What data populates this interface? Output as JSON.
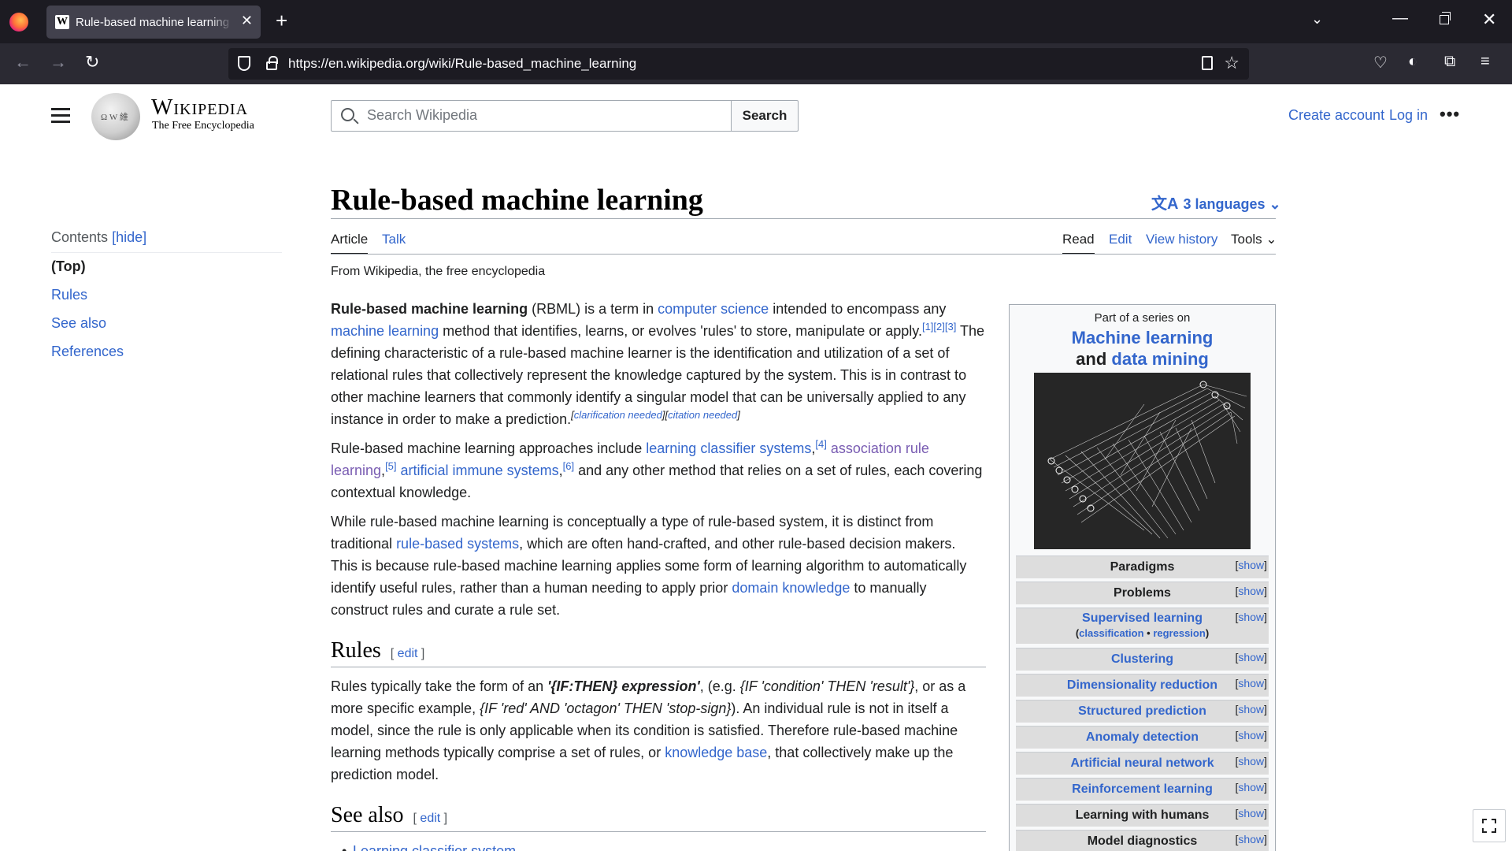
{
  "browser": {
    "tab_title": "Rule-based machine learning - Wikipedia",
    "url": "https://en.wikipedia.org/wiki/Rule-based_machine_learning",
    "icons": [
      "firefox-logo",
      "close-icon",
      "plus-icon",
      "chevron-down-icon",
      "minimize-icon",
      "restore-icon",
      "back-icon",
      "forward-icon",
      "reload-icon",
      "shield-icon",
      "lock-icon",
      "reader-icon",
      "star-icon",
      "pocket-icon",
      "account-icon",
      "extensions-icon",
      "menu-icon"
    ]
  },
  "header": {
    "wordmark": "Wikipedia",
    "tagline": "The Free Encyclopedia",
    "search_placeholder": "Search Wikipedia",
    "search_button": "Search",
    "create_account": "Create account",
    "login": "Log in",
    "more": "•••"
  },
  "toc": {
    "title": "Contents",
    "hide": "[hide]",
    "items": [
      "(Top)",
      "Rules",
      "See also",
      "References"
    ]
  },
  "article": {
    "title": "Rule-based machine learning",
    "languages": "3 languages",
    "tabs_left": [
      "Article",
      "Talk"
    ],
    "tabs_right": [
      "Read",
      "Edit",
      "View history",
      "Tools"
    ],
    "tagline": "From Wikipedia, the free encyclopedia",
    "p1": {
      "bold": "Rule-based machine learning",
      "t1": " (RBML) is a term in ",
      "l1": "computer science",
      "t2": " intended to encompass any ",
      "l2": "machine learning",
      "t3": " method that identifies, learns, or evolves 'rules' to store, manipulate or apply.",
      "refs": "[1][2][3]",
      "t4": " The defining characteristic of a rule-based machine learner is the identification and utilization of a set of relational rules that collectively represent the knowledge captured by the system. This is in contrast to other machine learners that commonly identify a singular model that can be universally applied to any instance in order to make a prediction.",
      "note1": "clarification needed",
      "note2": "citation needed"
    },
    "p2": {
      "t1": "Rule-based machine learning approaches include ",
      "l1": "learning classifier systems",
      "r1": "[4]",
      "l2": "association rule learning",
      "r2": "[5]",
      "l3": "artificial immune systems",
      "r3": "[6]",
      "t2": " and any other method that relies on a set of rules, each covering contextual knowledge."
    },
    "p3": {
      "t1": "While rule-based machine learning is conceptually a type of rule-based system, it is distinct from traditional ",
      "l1": "rule-based systems",
      "t2": ", which are often hand-crafted, and other rule-based decision makers. This is because rule-based machine learning applies some form of learning algorithm to automatically identify useful rules, rather than a human needing to apply prior ",
      "l2": "domain knowledge",
      "t3": " to manually construct rules and curate a rule set."
    },
    "rules_heading": "Rules",
    "see_also_heading": "See also",
    "edit_label": "edit",
    "rules_p": {
      "t1": "Rules typically take the form of an ",
      "b1": "'{IF:THEN} expression'",
      "t2": ", (e.g. ",
      "i1": "{IF 'condition' THEN 'result'}",
      "t3": ", or as a more specific example, ",
      "i2": "{IF 'red' AND 'octagon' THEN 'stop-sign}",
      "t4": "). An individual rule is not in itself a model, since the rule is only applicable when its condition is satisfied. Therefore rule-based machine learning methods typically comprise a set of rules, or ",
      "l1": "knowledge base",
      "t5": ", that collectively make up the prediction model."
    },
    "see_also_items": [
      "Learning classifier system"
    ]
  },
  "infobox": {
    "above": "Part of a series on",
    "title_link1": "Machine learning",
    "title_and": "and",
    "title_link2": "data mining",
    "show_label": "show",
    "rows": [
      {
        "label": "Paradigms",
        "link": false
      },
      {
        "label": "Problems",
        "link": false
      },
      {
        "label": "Supervised learning",
        "link": true,
        "sub1": "classification",
        "sub2": "regression"
      },
      {
        "label": "Clustering",
        "link": true
      },
      {
        "label": "Dimensionality reduction",
        "link": true
      },
      {
        "label": "Structured prediction",
        "link": true
      },
      {
        "label": "Anomaly detection",
        "link": true
      },
      {
        "label": "Artificial neural network",
        "link": true
      },
      {
        "label": "Reinforcement learning",
        "link": true
      },
      {
        "label": "Learning with humans",
        "link": false
      },
      {
        "label": "Model diagnostics",
        "link": false
      }
    ]
  },
  "colors": {
    "link": "#3366cc",
    "visited_link": "#795cb2",
    "text": "#202122",
    "chrome_dark": "#1c1b22"
  }
}
